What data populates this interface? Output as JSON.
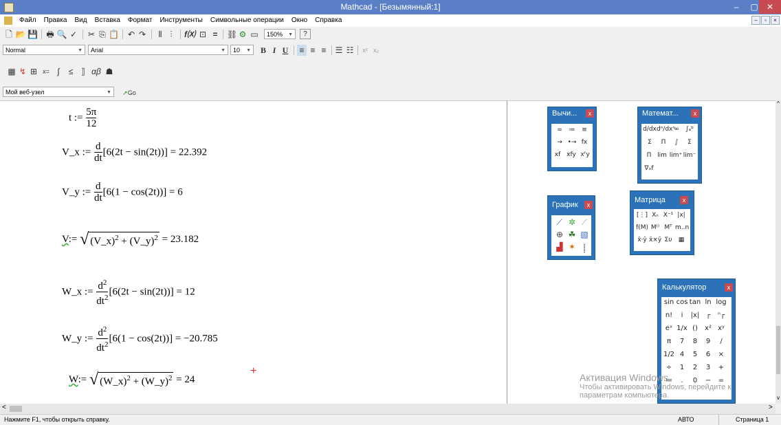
{
  "window": {
    "title": "Mathcad - [Безымянный:1]",
    "min": "–",
    "max": "▢",
    "close": "✕"
  },
  "menu": [
    "Файл",
    "Правка",
    "Вид",
    "Вставка",
    "Формат",
    "Инструменты",
    "Символьные операции",
    "Окно",
    "Справка"
  ],
  "mdi_controls": [
    "–",
    "▫",
    "×"
  ],
  "toolbar": {
    "zoom": "150%",
    "style": "Normal",
    "font": "Arial",
    "size": "10",
    "bold": "B",
    "italic": "I",
    "underline": "U",
    "web_address": "Мой веб-узел",
    "go": "Go"
  },
  "worksheet": {
    "t": {
      "lhs": "t :=",
      "num": "5π",
      "den": "12"
    },
    "vx": {
      "lhs": "V_x :=",
      "dnum": "d",
      "dden": "dt",
      "body": "[6(2t − sin(2t))] = 22.392"
    },
    "vy": {
      "lhs": "V_y :=",
      "dnum": "d",
      "dden": "dt",
      "body": "[6(1 − cos(2t))] = 6"
    },
    "v": {
      "lhs": "V",
      "assign": ":=",
      "rad": "(V_x)",
      "exp1": "2",
      "mid": " + (V_y)",
      "exp2": "2",
      "result": " = 23.182"
    },
    "wx": {
      "lhs": "W_x :=",
      "dnum": "d",
      "dnum_exp": "2",
      "dden": "dt",
      "dden_exp": "2",
      "body": "[6(2t − sin(2t))] = 12"
    },
    "wy": {
      "lhs": "W_y :=",
      "dnum": "d",
      "dnum_exp": "2",
      "dden": "dt",
      "dden_exp": "2",
      "body": "[6(1 − cos(2t))] = −20.785"
    },
    "w": {
      "lhs": "W",
      "assign": ":=",
      "rad": "(W_x)",
      "exp1": "2",
      "mid": " + (W_y)",
      "exp2": "2",
      "result": " = 24"
    },
    "cursor": "+"
  },
  "palettes": {
    "calc_small": {
      "title": "Вычи...",
      "close": "x",
      "items": [
        "=",
        "≔",
        "≡",
        "→",
        "•→",
        "fx",
        "xf",
        "xfy",
        "xᶠy"
      ]
    },
    "calculus": {
      "title": "Математ...",
      "close": "x",
      "items": [
        "d/dx",
        "dⁿ/dxⁿ",
        "∞",
        "∫ₐᵇ",
        "Σ",
        "Π",
        "∫",
        "Σ",
        "Π",
        "lim",
        "lim⁺",
        "lim⁻",
        "∇ₓf"
      ]
    },
    "graph": {
      "title": "График",
      "close": "x"
    },
    "matrix": {
      "title": "Матрица",
      "close": "x",
      "items": [
        "[⋮]",
        "Xₙ",
        "X⁻¹",
        "|x|",
        "f(M)",
        "M⁽⁾",
        "Mᵀ",
        "m..n",
        "x̄·ȳ",
        "x̄×ȳ",
        "Συ",
        "▦"
      ]
    },
    "calculator": {
      "title": "Калькулятор",
      "close": "x",
      "rows": [
        [
          "sin",
          "cos",
          "tan",
          "ln",
          "log"
        ],
        [
          "n!",
          "i",
          "|x|",
          "┌",
          "ⁿ┌"
        ],
        [
          "eˣ",
          "1/x",
          "()",
          "x²",
          "xʸ"
        ],
        [
          "π",
          "7",
          "8",
          "9",
          "/"
        ],
        [
          "1/2",
          "4",
          "5",
          "6",
          "×"
        ],
        [
          "÷",
          "1",
          "2",
          "3",
          "+"
        ],
        [
          "≔",
          ".",
          "0",
          "−",
          "="
        ]
      ]
    }
  },
  "watermark": {
    "line1": "Активация Windows",
    "line2": "Чтобы активировать Windows, перейдите к",
    "line3": "параметрам компьютера."
  },
  "status": {
    "help": "Нажмите F1, чтобы открыть справку.",
    "mode": "АВТО",
    "page": "Страница 1"
  }
}
